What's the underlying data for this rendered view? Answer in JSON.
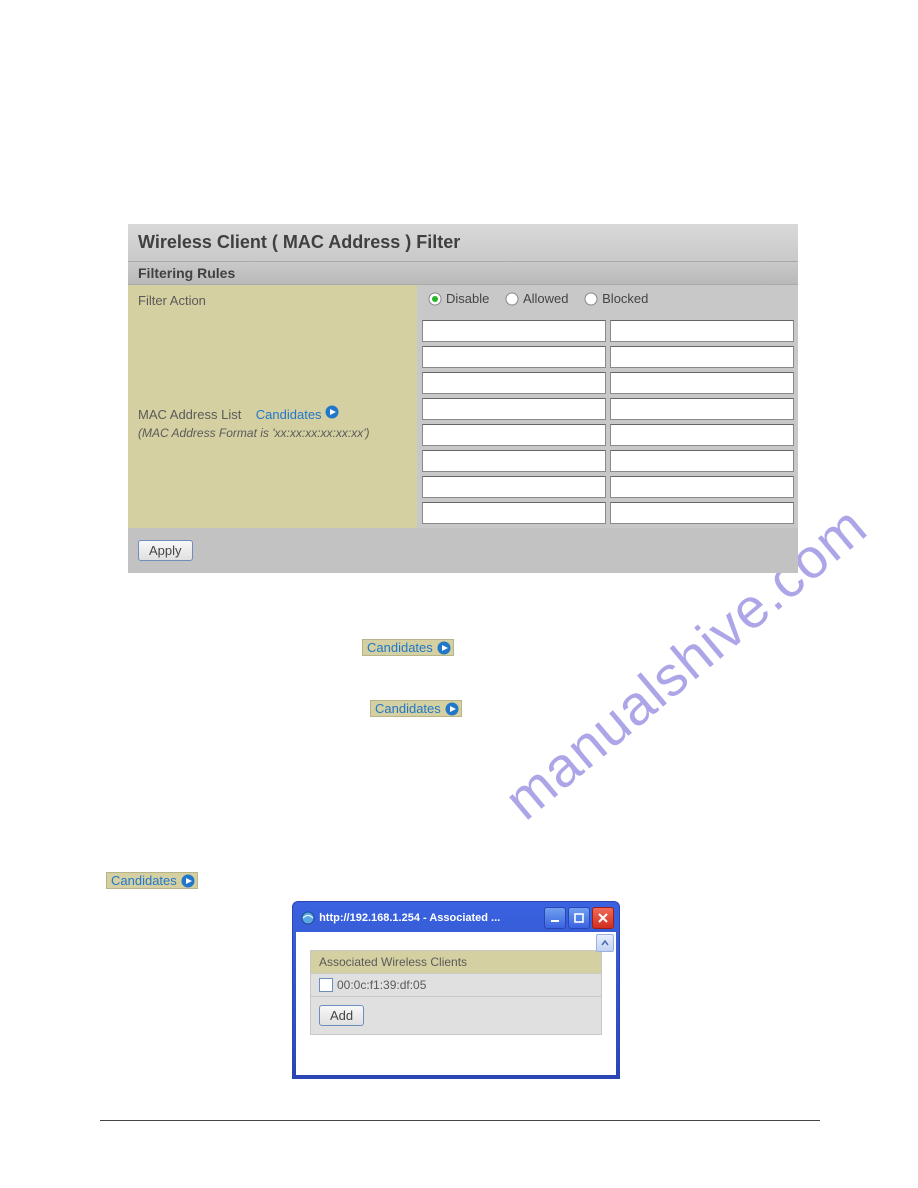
{
  "panel": {
    "title": "Wireless Client ( MAC Address ) Filter",
    "subtitle": "Filtering Rules",
    "filter_action_label": "Filter Action",
    "radios": {
      "disable": "Disable",
      "allowed": "Allowed",
      "blocked": "Blocked"
    },
    "mac_list_label": "MAC Address List",
    "candidates_label": "Candidates",
    "mac_format_note": "(MAC Address Format is 'xx:xx:xx:xx:xx:xx')",
    "apply_label": "Apply"
  },
  "badges": {
    "b1": "Candidates",
    "b2": "Candidates",
    "b3": "Candidates"
  },
  "popup": {
    "title": "http://192.168.1.254 - Associated ...",
    "section": "Associated Wireless Clients",
    "mac": "00:0c:f1:39:df:05",
    "add_label": "Add"
  },
  "watermark": "manualshive.com"
}
